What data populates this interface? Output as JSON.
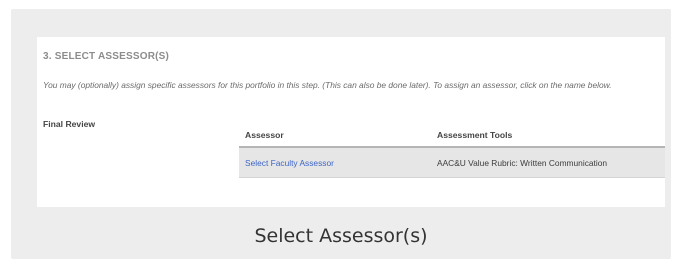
{
  "screenshot": {
    "section_title": "3. SELECT ASSESSOR(S)",
    "intro_text": "You may (optionally) assign specific assessors for this portfolio in this step. (This can also be done later). To assign an assessor, click on the name below.",
    "row_label": "Final Review",
    "table": {
      "headers": [
        "Assessor",
        "Assessment Tools"
      ],
      "rows": [
        {
          "assessor": "Select Faculty Assessor",
          "tool": "AAC&U Value Rubric: Written Communication"
        }
      ]
    }
  },
  "caption": "Select Assessor(s)",
  "colors": {
    "frame_background": "#ededed",
    "link": "#3d66c7",
    "row_background": "#e6e6e6"
  }
}
